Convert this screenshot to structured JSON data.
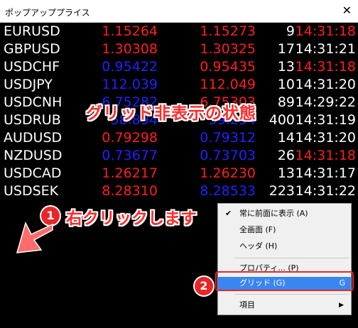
{
  "window": {
    "title": "ポップアッププライス",
    "close_glyph": "✕"
  },
  "rates": [
    {
      "symbol": "EURUSD",
      "bid": "1.15264",
      "ask": "1.15273",
      "count": "9",
      "time": "14:31:18",
      "bid_color": "red",
      "ask_color": "red",
      "time_color": "red"
    },
    {
      "symbol": "GBPUSD",
      "bid": "1.30308",
      "ask": "1.30325",
      "count": "17",
      "time": "14:31:21",
      "bid_color": "red",
      "ask_color": "red",
      "time_color": "white"
    },
    {
      "symbol": "USDCHF",
      "bid": "0.95422",
      "ask": "0.95435",
      "count": "13",
      "time": "14:31:18",
      "bid_color": "blue",
      "ask_color": "red",
      "time_color": "red"
    },
    {
      "symbol": "USDJPY",
      "bid": "112.039",
      "ask": "112.049",
      "count": "10",
      "time": "14:31:20",
      "bid_color": "blue",
      "ask_color": "red",
      "time_color": "white"
    },
    {
      "symbol": "USDCNH",
      "bid": "6.75282",
      "ask": "6.75303",
      "count": "89",
      "time": "14:29:22",
      "bid_color": "blue",
      "ask_color": "red",
      "time_color": "white"
    },
    {
      "symbol": "USDRUB",
      "bid": "58.894",
      "ask": "59.294",
      "count": "400",
      "time": "14:31:19",
      "bid_color": "blue",
      "ask_color": "blue",
      "time_color": "white"
    },
    {
      "symbol": "AUDUSD",
      "bid": "0.79298",
      "ask": "0.79312",
      "count": "14",
      "time": "14:31:20",
      "bid_color": "red",
      "ask_color": "blue",
      "time_color": "white"
    },
    {
      "symbol": "NZDUSD",
      "bid": "0.73677",
      "ask": "0.73703",
      "count": "26",
      "time": "14:31:18",
      "bid_color": "blue",
      "ask_color": "blue",
      "time_color": "red"
    },
    {
      "symbol": "USDCAD",
      "bid": "1.26217",
      "ask": "1.26230",
      "count": "13",
      "time": "14:31:17",
      "bid_color": "red",
      "ask_color": "red",
      "time_color": "white"
    },
    {
      "symbol": "USDSEK",
      "bid": "8.28310",
      "ask": "8.28533",
      "count": "223",
      "time": "14:31:22",
      "bid_color": "red",
      "ask_color": "blue",
      "time_color": "white"
    }
  ],
  "annotations": {
    "caption": "グリッド非表示の状態",
    "step1_number": "1",
    "step1_text": "右クリックします",
    "step2_number": "2"
  },
  "context_menu": {
    "always_on_top": {
      "label": "常に前面に表示 (A)",
      "checked": "✔"
    },
    "fullscreen": {
      "label": "全画面 (F)"
    },
    "header": {
      "label": "ヘッダ (H)"
    },
    "properties": {
      "label": "プロパティ... (P)"
    },
    "grid": {
      "label": "グリッド (G)",
      "shortcut": "G"
    },
    "items": {
      "label": "項目",
      "submenu_arrow": "▶"
    }
  },
  "colors": {
    "red": "#ff1e1e",
    "blue": "#1f22ff",
    "highlight": "#3a86f0",
    "badge": "#e8262a"
  }
}
